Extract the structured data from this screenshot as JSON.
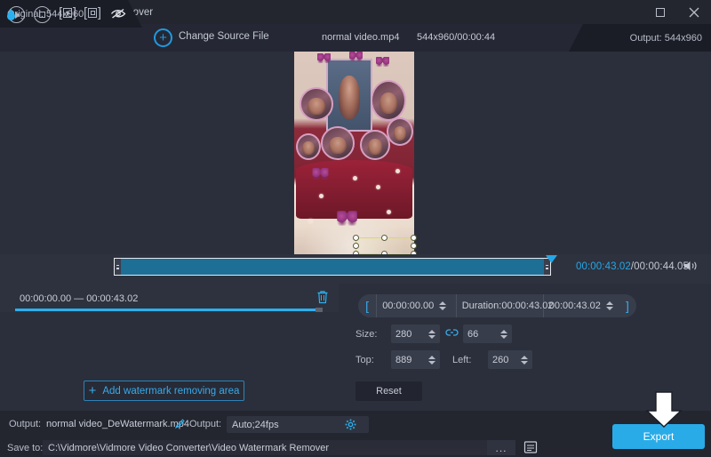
{
  "window": {
    "title": "Video Watermark Remover",
    "logo_icon": "app-logo-icon",
    "maximize_icon": "maximize-icon",
    "close_icon": "close-icon"
  },
  "source_bar": {
    "original_label": "Original: 544x960",
    "hide_icon": "eye-slash-icon",
    "add_icon": "plus-circle-icon",
    "change_source_label": "Change Source File",
    "file_name": "normal video.mp4",
    "file_meta": "544x960/00:00:44",
    "output_label": "Output: 544x960"
  },
  "preview": {
    "selection_name": "watermark-selection-box"
  },
  "timeline": {
    "play_icon": "play-icon",
    "stop_icon": "stop-icon",
    "mark_in_icon": "set-start-frame-icon",
    "mark_out_icon": "set-end-frame-icon",
    "current_time": "00:00:43.02",
    "total_time": "/00:00:44.05",
    "volume_icon": "speaker-icon"
  },
  "track": {
    "drop_icon": "watermark-drop-icon",
    "range_label": "00:00:00.00 — 00:00:43.02",
    "delete_icon": "trash-icon"
  },
  "left_panel": {
    "add_area_label": "Add watermark removing area",
    "add_area_icon": "plus-icon"
  },
  "right_panel": {
    "bracket_left": "[",
    "bracket_right": "]",
    "start_time": "00:00:00.00",
    "duration_label": "Duration:00:00:43.02",
    "end_time": "00:00:43.02",
    "size_label": "Size:",
    "size_width": "280",
    "size_height": "66",
    "link_icon": "link-ratio-icon",
    "top_label": "Top:",
    "top_value": "889",
    "left_label": "Left:",
    "left_value": "260",
    "reset_label": "Reset"
  },
  "output_bar": {
    "output_label": "Output:",
    "output_name": "normal video_DeWatermark.mp4",
    "edit_icon": "pencil-icon",
    "format_label": "Output:",
    "format_value": "Auto;24fps",
    "settings_icon": "gear-icon"
  },
  "bottom_bar": {
    "save_to_label": "Save to:",
    "save_path": "C:\\Vidmore\\Vidmore Video Converter\\Video Watermark Remover",
    "browse_label": "...",
    "folder_icon": "folder-icon",
    "export_label": "Export",
    "annotation_icon": "down-arrow-annotation"
  },
  "colors": {
    "accent": "#29abe8",
    "panel": "#2b2f3b",
    "titlebar": "#23262f",
    "selection": "#d9d96a"
  }
}
